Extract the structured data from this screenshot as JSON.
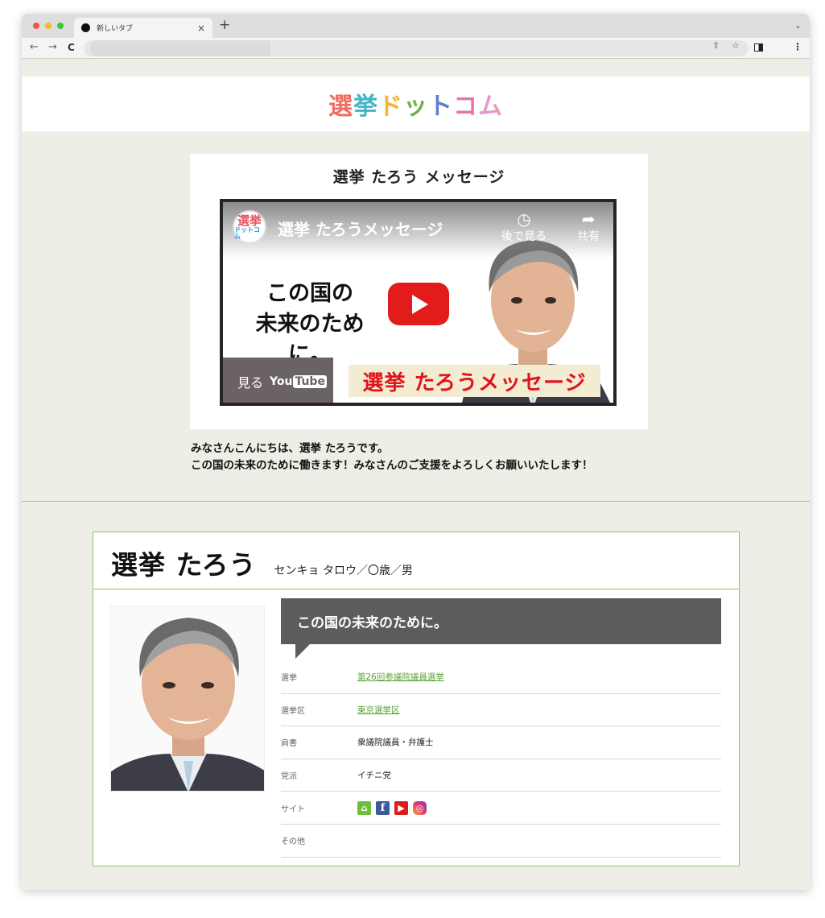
{
  "browser": {
    "tab_title": "新しいタブ",
    "tab_close": "×",
    "new_tab": "+",
    "tab_menu": "⌄",
    "back": "←",
    "forward": "→",
    "reload": "C",
    "share_icon": "⇧",
    "star_icon": "☆",
    "menu_icon": "⋮"
  },
  "site": {
    "logo": [
      "選",
      "挙",
      "ド",
      "ッ",
      "ト",
      "コ",
      "ム"
    ],
    "logo_colors": [
      "#ef6e63",
      "#41b6c9",
      "#f5b62a",
      "#6ab24a",
      "#5c7fd0",
      "#ee6fa8",
      "#e49ac6"
    ]
  },
  "message": {
    "title": "選挙 たろう メッセージ",
    "video": {
      "channel_icon_top": "選挙",
      "channel_icon_bottom": "ドットコム",
      "title": "選挙 たろうメッセージ",
      "watch_later": "後で見る",
      "share": "共有",
      "headline_line1": "この国の",
      "headline_line2": "未来のために。",
      "watch_on": "見る",
      "youtube_you": "You",
      "youtube_tube": "Tube",
      "banner": "選挙 たろうメッセージ"
    },
    "greeting_line1": "みなさんこんにちは、選挙 たろうです。",
    "greeting_line2": "この国の未来のために働きます！みなさんのご支援をよろしくお願いいたします！"
  },
  "profile": {
    "name": "選挙 たろう",
    "kana_age_gender": "センキョ タロウ／〇歳／男",
    "catchphrase": "この国の未来のために。",
    "rows": [
      {
        "key": "選挙",
        "value": "第26回参議院議員選挙"
      },
      {
        "key": "選挙区",
        "value": "東京選挙区"
      },
      {
        "key": "肩書",
        "value": "衆議院議員・弁護士"
      },
      {
        "key": "党派",
        "value": "イチニ党"
      },
      {
        "key": "サイト",
        "value": ""
      },
      {
        "key": "その他",
        "value": ""
      }
    ],
    "site_icons": [
      "home-icon",
      "facebook-icon",
      "youtube-icon",
      "instagram-icon"
    ]
  }
}
